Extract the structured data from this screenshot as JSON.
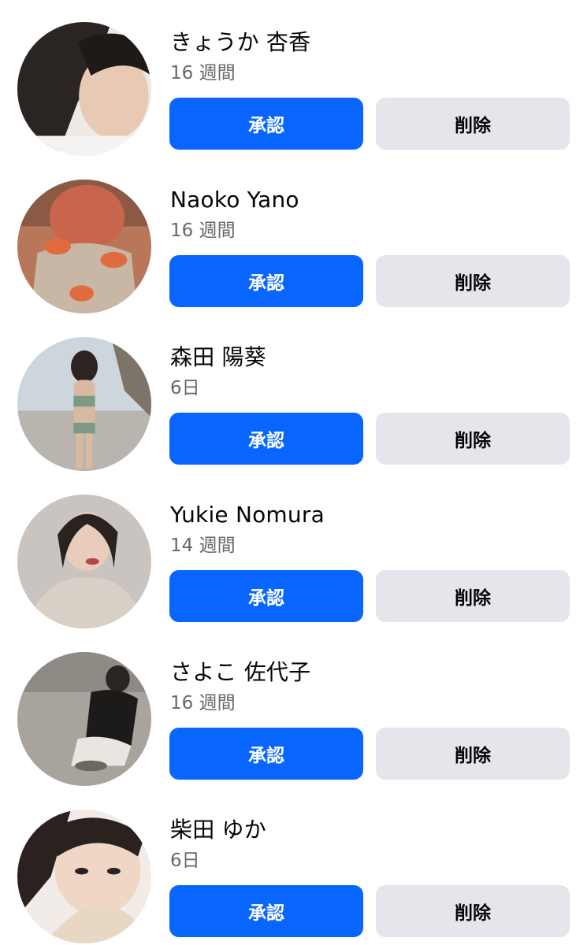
{
  "requests": [
    {
      "name": "きょうか 杏香",
      "time": "16 週間",
      "confirm_label": "承認",
      "delete_label": "削除"
    },
    {
      "name": "Naoko Yano",
      "time": "16 週間",
      "confirm_label": "承認",
      "delete_label": "削除"
    },
    {
      "name": "森田 陽葵",
      "time": "6日",
      "confirm_label": "承認",
      "delete_label": "削除"
    },
    {
      "name": "Yukie Nomura",
      "time": "14 週間",
      "confirm_label": "承認",
      "delete_label": "削除"
    },
    {
      "name": "さよこ 佐代子",
      "time": "16 週間",
      "confirm_label": "承認",
      "delete_label": "削除"
    },
    {
      "name": "柴田 ゆか",
      "time": "6日",
      "confirm_label": "承認",
      "delete_label": "削除"
    }
  ],
  "colors": {
    "confirm_bg": "#0866ff",
    "delete_bg": "#e4e6eb",
    "secondary_text": "#65676b"
  }
}
